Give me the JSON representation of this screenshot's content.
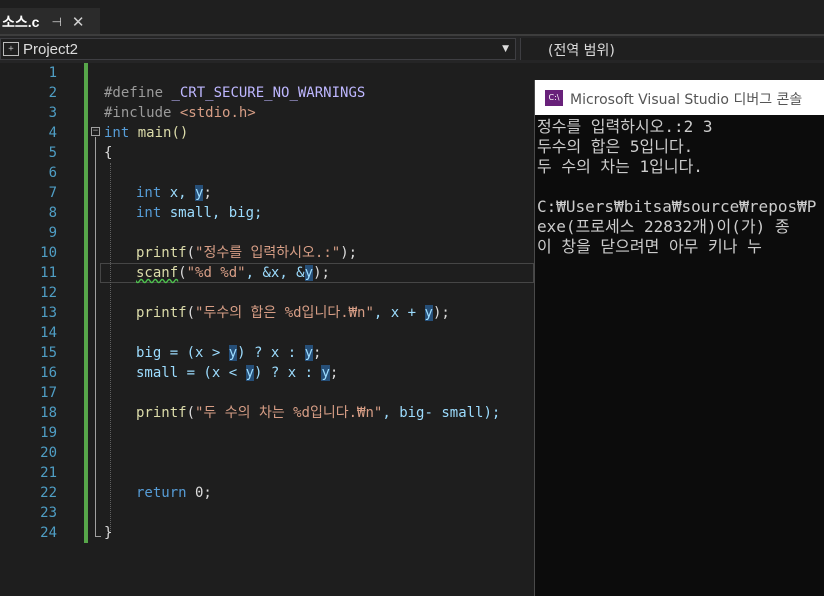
{
  "tab": {
    "filename": "소스.c",
    "pin_glyph": "⊣",
    "close_glyph": "✕"
  },
  "nav": {
    "project": "Project2",
    "scope": "(전역 범위)"
  },
  "line_numbers": [
    "1",
    "2",
    "3",
    "4",
    "5",
    "6",
    "7",
    "8",
    "9",
    "10",
    "11",
    "12",
    "13",
    "14",
    "15",
    "16",
    "17",
    "18",
    "19",
    "20",
    "21",
    "22",
    "23",
    "24"
  ],
  "code": {
    "l2_directive": "#define",
    "l2_macro": " _CRT_SECURE_NO_WARNINGS",
    "l3_directive": "#include",
    "l3_header": " <stdio.h>",
    "l4_kw": "int",
    "l4_rest": " main()",
    "l5": "{",
    "l7_kw": "int",
    "l7_rest": " x, ",
    "l7_y": "y",
    "l7_end": ";",
    "l8_kw": "int",
    "l8_rest": " small, big;",
    "l10_fn": "printf",
    "l10_open": "(",
    "l10_str": "\"정수를 입력하시오.:\"",
    "l10_end": ");",
    "l11_fn": "scanf",
    "l11_open": "(",
    "l11_str": "\"%d %d\"",
    "l11_mid": ", &x, &",
    "l11_y": "y",
    "l11_end": ");",
    "l13_fn": "printf",
    "l13_open": "(",
    "l13_str": "\"두수의 합은 %d입니다.₩n\"",
    "l13_mid": ", x + ",
    "l13_y": "y",
    "l13_end": ");",
    "l15_a": "big = (x > ",
    "l15_y1": "y",
    "l15_b": ") ? x : ",
    "l15_y2": "y",
    "l15_end": ";",
    "l16_a": "small = (x < ",
    "l16_y1": "y",
    "l16_b": ") ? x : ",
    "l16_y2": "y",
    "l16_end": ";",
    "l18_fn": "printf",
    "l18_open": "(",
    "l18_str": "\"두 수의 차는 %d입니다.₩n\"",
    "l18_end": ", big- small);",
    "l22_kw": "return",
    "l22_rest": " 0;",
    "l24": "}"
  },
  "console": {
    "title": "Microsoft Visual Studio 디버그 콘솔",
    "icon_text": "C:\\",
    "lines": [
      "정수를 입력하시오.:2 3",
      "두수의 합은 5입니다.",
      "두 수의 차는 1입니다.",
      "",
      "C:₩Users₩bitsa₩source₩repos₩P",
      "exe(프로세스 22832개)이(가) 종",
      "이 창을 닫으려면 아무 키나 누"
    ]
  }
}
